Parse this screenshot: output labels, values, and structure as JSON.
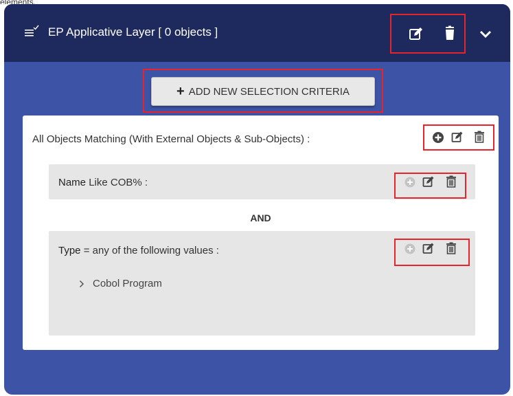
{
  "top_text": "elements.",
  "header": {
    "title": "EP Applicative Layer [ 0 objects ]",
    "icons": [
      "menu-check-icon",
      "edit-icon",
      "trash-icon",
      "chevron-down-icon"
    ]
  },
  "add_criteria": {
    "plus": "+",
    "label": "ADD NEW SELECTION CRITERIA"
  },
  "group": {
    "title": "All Objects Matching (With External Objects & Sub-Objects) :",
    "operator": "AND",
    "criteria": [
      {
        "field": "Name",
        "condition": "Like COB% :"
      },
      {
        "field": "Type",
        "condition": "= any of the following values :",
        "values": [
          "Cobol Program"
        ]
      }
    ]
  },
  "colors": {
    "header_bg": "#1e2a5e",
    "panel_bg": "#3d54a6",
    "highlight": "#e8232b"
  }
}
